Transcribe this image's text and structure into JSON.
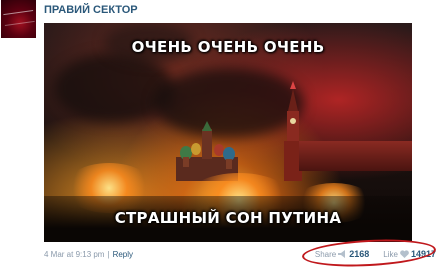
{
  "post": {
    "author": "ПРАВИЙ СЕКТОР",
    "image": {
      "caption_top": "ОЧЕНЬ ОЧЕНЬ ОЧЕНЬ",
      "caption_bottom": "СТРАШНЫЙ СОН ПУТИНА"
    },
    "timestamp": "4 Mar at 9:13 pm",
    "separator": "|",
    "reply_label": "Reply",
    "share": {
      "label": "Share",
      "count": "2168",
      "icon": "megaphone-icon"
    },
    "like": {
      "label": "Like",
      "count": "14917",
      "icon": "heart-icon"
    }
  },
  "colors": {
    "link": "#2b587a",
    "muted": "#8b9aab",
    "highlight": "#c0181c"
  }
}
